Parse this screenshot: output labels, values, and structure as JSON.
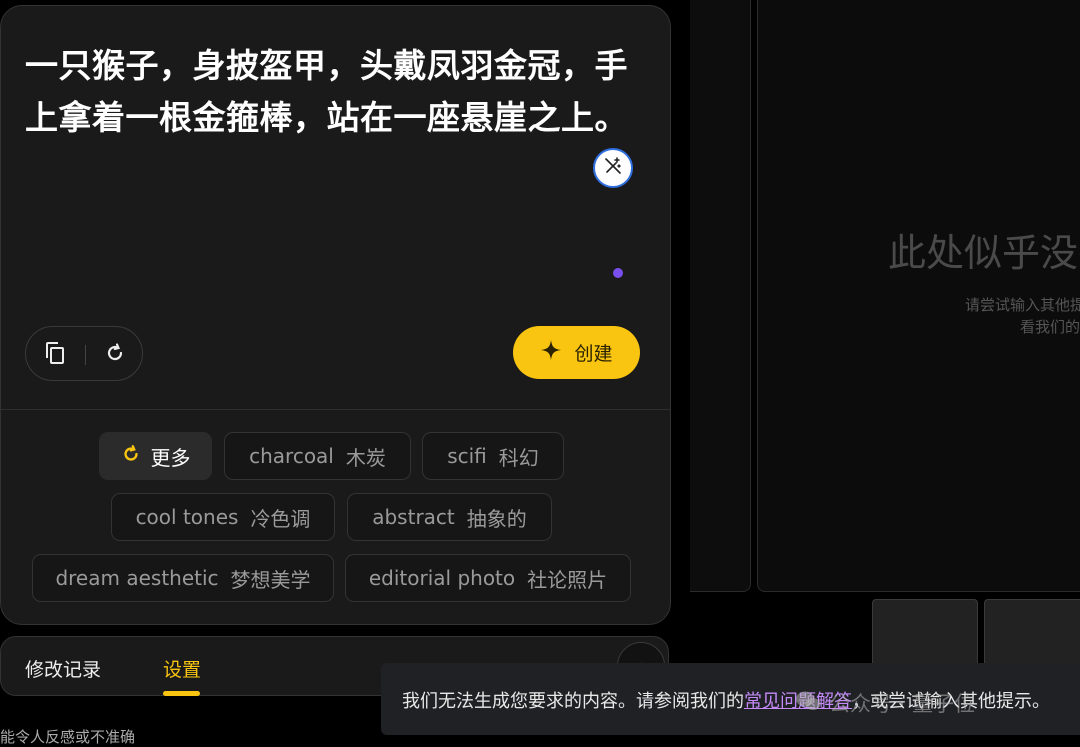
{
  "prompt": {
    "text": "一只猴子，身披盔甲，头戴凤羽金冠，手上拿着一根金箍棒，站在一座悬崖之上。"
  },
  "actions": {
    "create_label": "创建"
  },
  "chips": {
    "more": "更多",
    "items": [
      {
        "en": "charcoal",
        "zh": "木炭"
      },
      {
        "en": "scifi",
        "zh": "科幻"
      },
      {
        "en": "cool tones",
        "zh": "冷色调"
      },
      {
        "en": "abstract",
        "zh": "抽象的"
      },
      {
        "en": "dream aesthetic",
        "zh": "梦想美学"
      },
      {
        "en": "editorial photo",
        "zh": "社论照片"
      }
    ]
  },
  "tabs": {
    "history": "修改记录",
    "settings": "设置"
  },
  "empty_state": {
    "title": "此处似乎没有",
    "line1": "请尝试输入其他提",
    "line2": "看我们的"
  },
  "toast": {
    "before": "我们无法生成您要求的内容。请参阅我们的",
    "link": "常见问题解答",
    "after": "，或尝试输入其他提示。"
  },
  "watermark": "公众号 · 量子位",
  "disclaimer": "能令人反感或不准确",
  "colors": {
    "accent": "#f9c510",
    "link": "#c58af9",
    "dot": "#7a4ff0"
  },
  "icons": {
    "enhance": "magic-wand-icon",
    "copy": "copy-icon",
    "refresh": "refresh-icon",
    "create": "sparkle-icon",
    "more": "refresh-icon",
    "expand": "chevron-up-icon"
  }
}
